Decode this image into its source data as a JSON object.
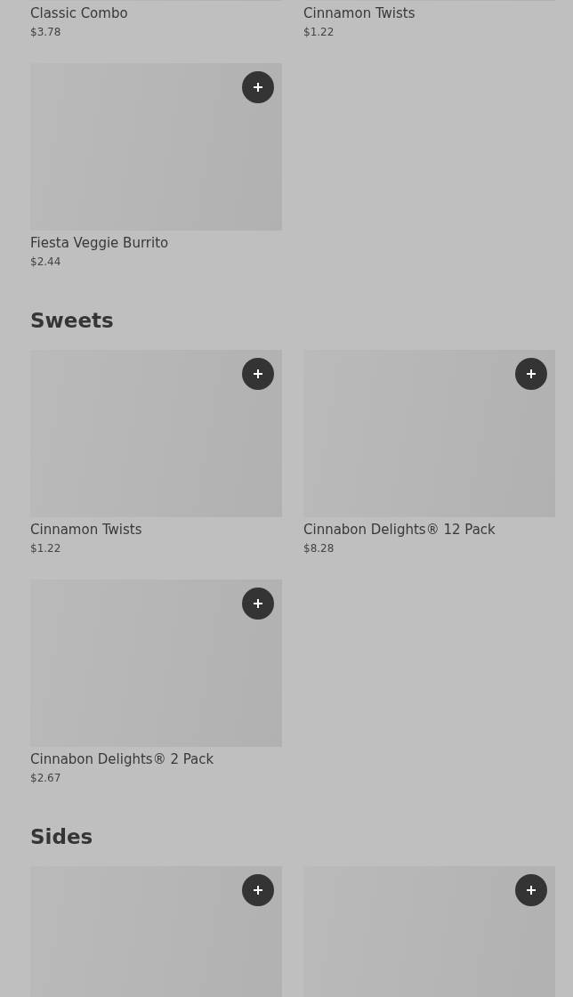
{
  "sections": [
    {
      "items": [
        {
          "kind": "card",
          "add_button": false,
          "name": "Classic Combo",
          "price": "$3.78"
        },
        {
          "kind": "card",
          "add_button": false,
          "name": "Cinnamon Twists",
          "price": "$1.22"
        },
        {
          "kind": "card",
          "add_button": true,
          "name": "Fiesta Veggie Burrito",
          "price": "$2.44"
        }
      ]
    },
    {
      "title": "Sweets",
      "items": [
        {
          "kind": "card",
          "add_button": true,
          "name": "Cinnamon Twists",
          "price": "$1.22"
        },
        {
          "kind": "card",
          "add_button": true,
          "name": "Cinnabon Delights® 12 Pack",
          "price": "$8.28"
        },
        {
          "kind": "card",
          "add_button": true,
          "name": "Cinnabon Delights® 2 Pack",
          "price": "$2.67"
        }
      ]
    },
    {
      "title": "Sides",
      "items": [
        {
          "kind": "card",
          "add_button": true
        },
        {
          "kind": "card",
          "add_button": true
        }
      ]
    }
  ]
}
